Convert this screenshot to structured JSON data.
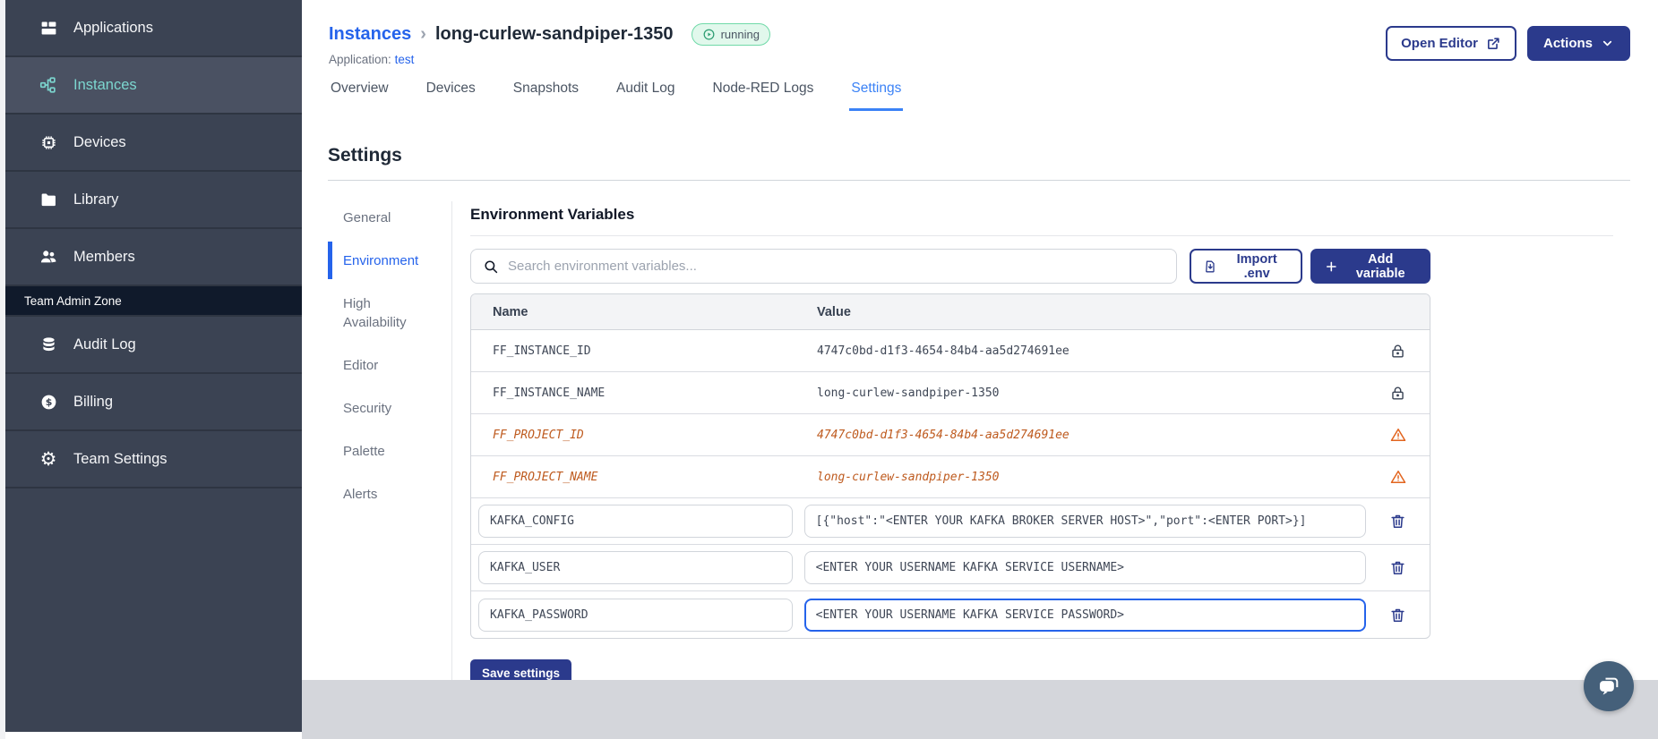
{
  "sidebar": {
    "items": [
      {
        "label": "Applications",
        "icon": "applications-icon",
        "active": false
      },
      {
        "label": "Instances",
        "icon": "instances-icon",
        "active": true
      },
      {
        "label": "Devices",
        "icon": "devices-icon",
        "active": false
      },
      {
        "label": "Library",
        "icon": "library-icon",
        "active": false
      },
      {
        "label": "Members",
        "icon": "members-icon",
        "active": false
      }
    ],
    "section_label": "Team Admin Zone",
    "admin_items": [
      {
        "label": "Audit Log",
        "icon": "audit-log-icon"
      },
      {
        "label": "Billing",
        "icon": "billing-icon"
      },
      {
        "label": "Team Settings",
        "icon": "team-settings-icon"
      }
    ]
  },
  "header": {
    "breadcrumb_root": "Instances",
    "breadcrumb_separator": "›",
    "instance_name": "long-curlew-sandpiper-1350",
    "status_badge": "running",
    "application_label": "Application:",
    "application_name": "test",
    "open_editor_label": "Open Editor",
    "actions_label": "Actions"
  },
  "tabs": [
    {
      "label": "Overview",
      "active": false
    },
    {
      "label": "Devices",
      "active": false
    },
    {
      "label": "Snapshots",
      "active": false
    },
    {
      "label": "Audit Log",
      "active": false
    },
    {
      "label": "Node-RED Logs",
      "active": false
    },
    {
      "label": "Settings",
      "active": true
    }
  ],
  "settings": {
    "title": "Settings",
    "nav": [
      {
        "label": "General",
        "active": false
      },
      {
        "label": "Environment",
        "active": true
      },
      {
        "label": "High Availability",
        "active": false
      },
      {
        "label": "Editor",
        "active": false
      },
      {
        "label": "Security",
        "active": false
      },
      {
        "label": "Palette",
        "active": false
      },
      {
        "label": "Alerts",
        "active": false
      }
    ],
    "panel": {
      "title": "Environment Variables",
      "search_placeholder": "Search environment variables...",
      "import_label": "Import .env",
      "add_label": "Add variable",
      "save_label": "Save settings",
      "table": {
        "columns": [
          "Name",
          "Value"
        ],
        "rows": [
          {
            "name": "FF_INSTANCE_ID",
            "value": "4747c0bd-d1f3-4654-84b4-aa5d274691ee",
            "type": "locked",
            "icon": "lock-icon"
          },
          {
            "name": "FF_INSTANCE_NAME",
            "value": "long-curlew-sandpiper-1350",
            "type": "locked",
            "icon": "lock-icon"
          },
          {
            "name": "FF_PROJECT_ID",
            "value": "4747c0bd-d1f3-4654-84b4-aa5d274691ee",
            "type": "deprecated",
            "icon": "warning-icon"
          },
          {
            "name": "FF_PROJECT_NAME",
            "value": "long-curlew-sandpiper-1350",
            "type": "deprecated",
            "icon": "warning-icon"
          },
          {
            "name": "KAFKA_CONFIG",
            "value": "[{\"host\":\"<ENTER YOUR KAFKA BROKER SERVER HOST>\",\"port\":<ENTER PORT>}]",
            "type": "editable",
            "icon": "trash-icon",
            "focused": false
          },
          {
            "name": "KAFKA_USER",
            "value": "<ENTER YOUR USERNAME KAFKA SERVICE USERNAME>",
            "type": "editable",
            "icon": "trash-icon",
            "focused": false
          },
          {
            "name": "KAFKA_PASSWORD",
            "value": "<ENTER YOUR USERNAME KAFKA SERVICE PASSWORD>",
            "type": "editable",
            "icon": "trash-icon",
            "focused": true
          }
        ]
      }
    }
  },
  "colors": {
    "primary_navy": "#2B3A8C",
    "link_blue": "#2563EB",
    "active_tab_blue": "#3B82F6",
    "sidebar_bg": "#3B4353",
    "sidebar_active_teal": "#7CD6CF",
    "status_running_green": "#2F9E73",
    "warning_orange": "#E2641E",
    "deprecated_text": "#BE5A1E",
    "footer_gray": "#D4D6DB"
  }
}
